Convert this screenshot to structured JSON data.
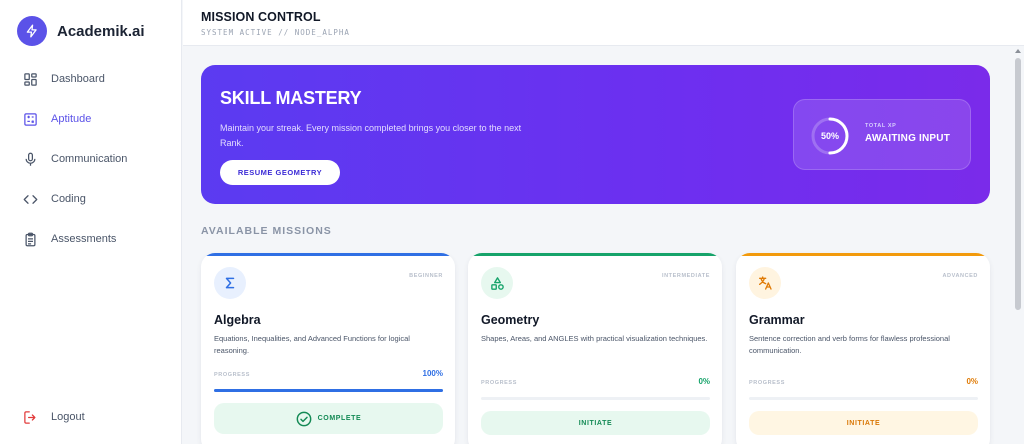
{
  "app": {
    "name": "Academik.ai"
  },
  "sidebar": {
    "items": [
      {
        "label": "Dashboard",
        "icon": "dashboard-icon"
      },
      {
        "label": "Aptitude",
        "icon": "calculator-icon",
        "active": true
      },
      {
        "label": "Communication",
        "icon": "microphone-icon"
      },
      {
        "label": "Coding",
        "icon": "code-icon"
      },
      {
        "label": "Assessments",
        "icon": "clipboard-icon"
      }
    ],
    "logout_label": "Logout"
  },
  "header": {
    "title": "MISSION CONTROL",
    "subtitle": "SYSTEM ACTIVE // NODE_ALPHA"
  },
  "hero": {
    "title": "SKILL MASTERY",
    "description": "Maintain your streak. Every mission completed brings you closer to the next Rank.",
    "button_label": "RESUME GEOMETRY",
    "xp": {
      "percent_label": "50%",
      "progress": 0.5,
      "label": "TOTAL XP",
      "value": "AWAITING INPUT"
    }
  },
  "missions": {
    "section_title": "AVAILABLE MISSIONS",
    "cards": [
      {
        "title": "Algebra",
        "level": "BEGINNER",
        "description": "Equations, Inequalities, and Advanced Functions for logical reasoning.",
        "progress_label": "PROGRESS",
        "progress_value": "100%",
        "progress": 1.0,
        "button_label": "COMPLETE",
        "accent": "#2f6fe4",
        "icon": "sigma-icon"
      },
      {
        "title": "Geometry",
        "level": "INTERMEDIATE",
        "description": "Shapes, Areas, and ANGLES with practical visualization techniques.",
        "progress_label": "PROGRESS",
        "progress_value": "0%",
        "progress": 0,
        "button_label": "INITIATE",
        "accent": "#16a36a",
        "icon": "shapes-icon"
      },
      {
        "title": "Grammar",
        "level": "ADVANCED",
        "description": "Sentence correction and verb forms for flawless professional communication.",
        "progress_label": "PROGRESS",
        "progress_value": "0%",
        "progress": 0,
        "button_label": "INITIATE",
        "accent": "#f29a0c",
        "icon": "translate-icon"
      }
    ]
  },
  "colors": {
    "brand": "#5b52e8",
    "hero_start": "#5b3bf1",
    "hero_end": "#7a2bea",
    "logout": "#e23b3b"
  }
}
